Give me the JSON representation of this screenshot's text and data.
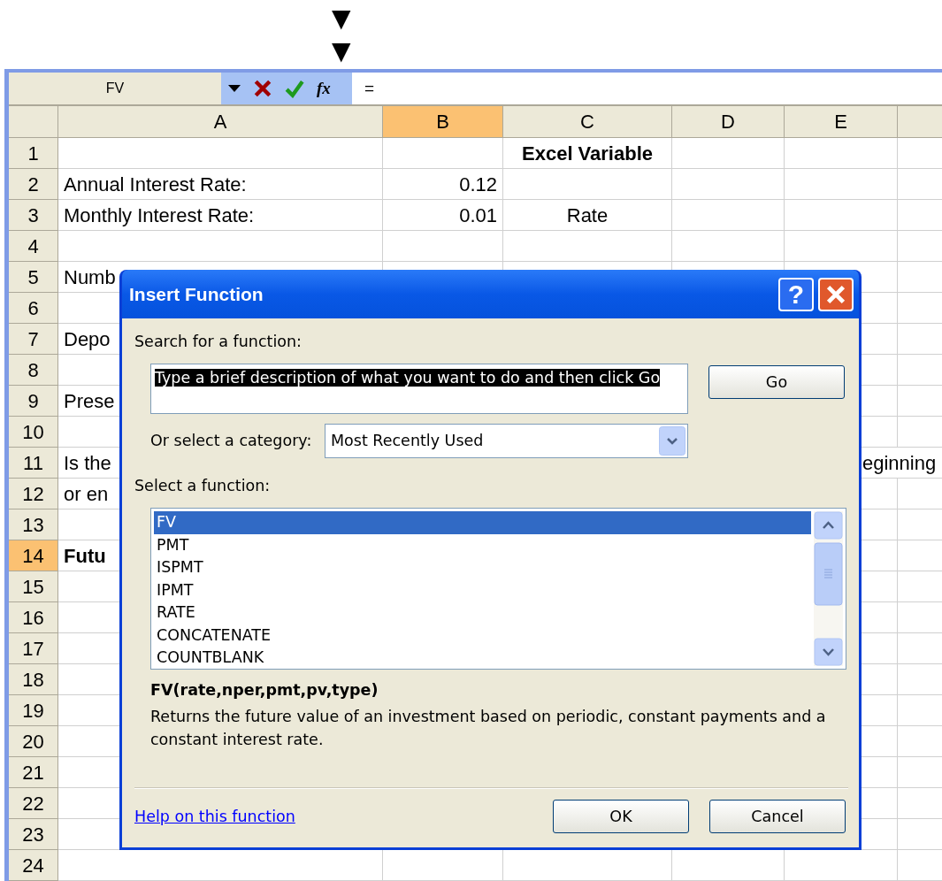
{
  "markers": [
    "▼",
    "▼"
  ],
  "formula_bar": {
    "name_box": "FV",
    "insert_function": "fx",
    "formula": "="
  },
  "columns": [
    {
      "label": "A",
      "selected": false
    },
    {
      "label": "B",
      "selected": true
    },
    {
      "label": "C",
      "selected": false
    },
    {
      "label": "D",
      "selected": false
    },
    {
      "label": "E",
      "selected": false
    }
  ],
  "rows": [
    {
      "number": "1",
      "selected": false,
      "cells": {
        "c": {
          "text": "Excel Variable",
          "bold": true
        }
      }
    },
    {
      "number": "2",
      "selected": false,
      "cells": {
        "a": {
          "text": "Annual Interest Rate:",
          "bold": false
        },
        "b": {
          "text": "0.12",
          "bold": false
        }
      }
    },
    {
      "number": "3",
      "selected": false,
      "cells": {
        "a": {
          "text": "Monthly Interest Rate:",
          "bold": false
        },
        "b": {
          "text": "0.01",
          "bold": false
        },
        "c": {
          "text": "Rate",
          "bold": false
        }
      }
    },
    {
      "number": "4",
      "selected": false
    },
    {
      "number": "5",
      "selected": false,
      "cells": {
        "a": {
          "text": "Numb",
          "bold": false
        }
      }
    },
    {
      "number": "6",
      "selected": false
    },
    {
      "number": "7",
      "selected": false,
      "cells": {
        "a": {
          "text": "Depo",
          "bold": false
        }
      }
    },
    {
      "number": "8",
      "selected": false
    },
    {
      "number": "9",
      "selected": false,
      "cells": {
        "a": {
          "text": "Prese",
          "bold": false
        }
      }
    },
    {
      "number": "10",
      "selected": false
    },
    {
      "number": "11",
      "selected": false,
      "cells": {
        "a": {
          "text": "Is the",
          "bold": false
        },
        "e": {
          "text": "eginning",
          "bold": false
        }
      }
    },
    {
      "number": "12",
      "selected": false,
      "cells": {
        "a": {
          "text": "or en",
          "bold": false
        }
      }
    },
    {
      "number": "13",
      "selected": false
    },
    {
      "number": "14",
      "selected": true,
      "cells": {
        "a": {
          "text": "Futu",
          "bold": true
        }
      }
    },
    {
      "number": "15",
      "selected": false
    },
    {
      "number": "16",
      "selected": false
    },
    {
      "number": "17",
      "selected": false
    },
    {
      "number": "18",
      "selected": false
    },
    {
      "number": "19",
      "selected": false
    },
    {
      "number": "20",
      "selected": false
    },
    {
      "number": "21",
      "selected": false
    },
    {
      "number": "22",
      "selected": false
    },
    {
      "number": "23",
      "selected": false
    },
    {
      "number": "24",
      "selected": false
    }
  ],
  "dialog": {
    "title": "Insert Function",
    "help_button": "?",
    "search_label": "Search for a function:",
    "search_field": {
      "value": "Type a brief description of what you want to do and then click Go",
      "highlighted": true
    },
    "go_button": "Go",
    "category_label": "Or select a category:",
    "category": "Most Recently Used",
    "function_label": "Select a function:",
    "functions": [
      {
        "name": "FV",
        "selected": true
      },
      {
        "name": "PMT",
        "selected": false
      },
      {
        "name": "ISPMT",
        "selected": false
      },
      {
        "name": "IPMT",
        "selected": false
      },
      {
        "name": "RATE",
        "selected": false
      },
      {
        "name": "CONCATENATE",
        "selected": false
      },
      {
        "name": "COUNTBLANK",
        "selected": false
      }
    ],
    "signature": "FV(rate,nper,pmt,pv,type)",
    "description": "Returns the future value of an investment based on periodic, constant payments and a constant interest rate.",
    "help_link": "Help on this function",
    "buttons": [
      "OK",
      "Cancel"
    ]
  }
}
